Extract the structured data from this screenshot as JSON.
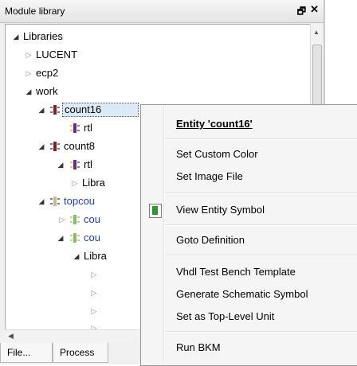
{
  "panel": {
    "title": "Module library",
    "float_icon": "🗗",
    "close_icon": "✕"
  },
  "tree": {
    "libraries": "Libraries",
    "lucent": "LUCENT",
    "ecp2": "ecp2",
    "work": "work",
    "count16": "count16",
    "count16_rtl": "rtl",
    "count8": "count8",
    "count8_rtl": "rtl",
    "count8_libr": "Libra",
    "topcount": "topcou",
    "top_child1": "cou",
    "top_child2": "cou",
    "top_libr": "Libra"
  },
  "tabs": {
    "files": "File...",
    "process": "Process"
  },
  "menu": {
    "entity": "Entity 'count16'",
    "set_custom_color": "Set Custom Color",
    "set_image_file": "Set Image File",
    "view_entity_symbol": "View Entity Symbol",
    "goto_definition": "Goto Definition",
    "vhdl_test_bench": "Vhdl Test Bench Template",
    "generate_schematic": "Generate Schematic Symbol",
    "set_top_level": "Set as Top-Level Unit",
    "run_bkm": "Run BKM"
  },
  "colors": {
    "entity_red": "#8b1a2b",
    "arch_purple": "#6a2a8a",
    "top_blue": "#1a3cc8",
    "selection": "#dceaf8",
    "symbol_green": "#2a9a2a"
  }
}
